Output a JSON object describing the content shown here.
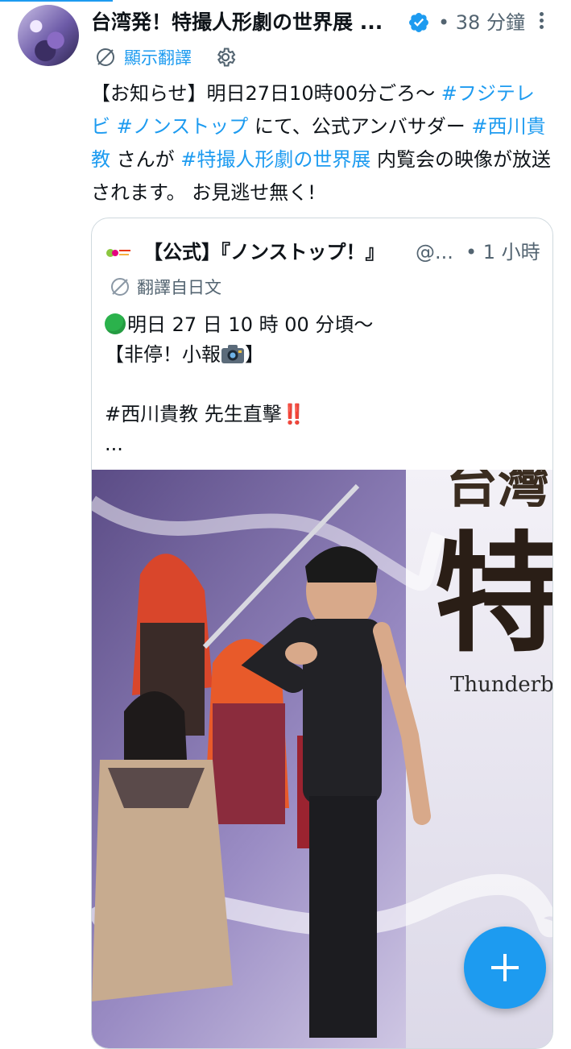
{
  "tweet": {
    "author_name": "台湾発！特撮人形劇の世界展 ...",
    "time": "• 38 分鐘",
    "translate_label": "顯示翻譯",
    "text_segments": [
      {
        "t": "【お知らせ】明日27日10時00分ごろ〜 ",
        "tag": false
      },
      {
        "t": "#フジテレビ",
        "tag": true
      },
      {
        "t": " ",
        "tag": false
      },
      {
        "t": "#ノンストップ",
        "tag": true
      },
      {
        "t": " にて、公式アンバサダー ",
        "tag": false
      },
      {
        "t": "#西川貴教",
        "tag": true
      },
      {
        "t": " さんが ",
        "tag": false
      },
      {
        "t": "#特撮人形劇の世界展",
        "tag": true
      },
      {
        "t": " 内覧会の映像が放送されます。 お見逃せ無く!",
        "tag": false
      }
    ]
  },
  "quote": {
    "name": "【公式】『ノンストップ！』",
    "handle": "@...",
    "time": "• 1 小時",
    "translate_label": "翻譯自日文",
    "line1": "明日 27 日 10 時 00 分頃〜",
    "line2": "【非停！小報",
    "line2_end": "】",
    "line4": "#西川貴教 先生直擊",
    "line4_emoji": "‼️",
    "line5": "...",
    "photo_text": {
      "banner_top": "台灣",
      "banner_kanji": "特",
      "banner_english": "Thunderbol"
    }
  },
  "colors": {
    "accent": "#1d9bf0",
    "secondary_text": "#536471",
    "border": "#cfd9de"
  },
  "icons": {
    "verified": "verified-badge-icon",
    "more": "more-vertical-icon",
    "translate": "translate-globe-icon",
    "settings": "gear-icon",
    "compose": "plus-icon"
  }
}
